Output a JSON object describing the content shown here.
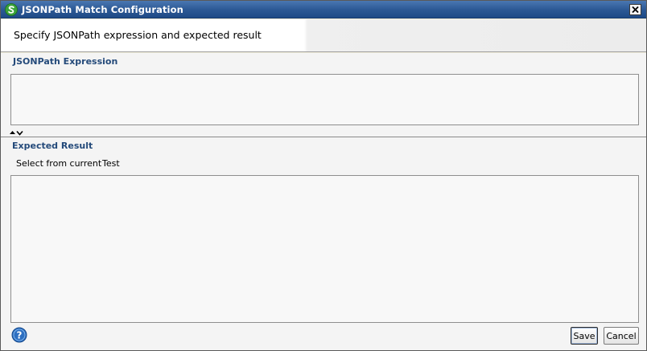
{
  "window": {
    "title": "JSONPath Match Configuration"
  },
  "header": {
    "title": "Specify JSONPath expression and expected result"
  },
  "expression": {
    "label": "JSONPath Expression",
    "value": ""
  },
  "expected": {
    "label": "Expected Result",
    "select_from_current": "Select from current",
    "test": "Test",
    "value": ""
  },
  "footer": {
    "save_label": "Save",
    "cancel_label": "Cancel"
  },
  "icons": {
    "app": "soapui-logo-icon",
    "close": "close-icon",
    "splitter": "collapse-expand-icon",
    "help": "help-icon"
  },
  "colors": {
    "titlebar": "#2d5a96",
    "section_label": "#244a7a"
  }
}
